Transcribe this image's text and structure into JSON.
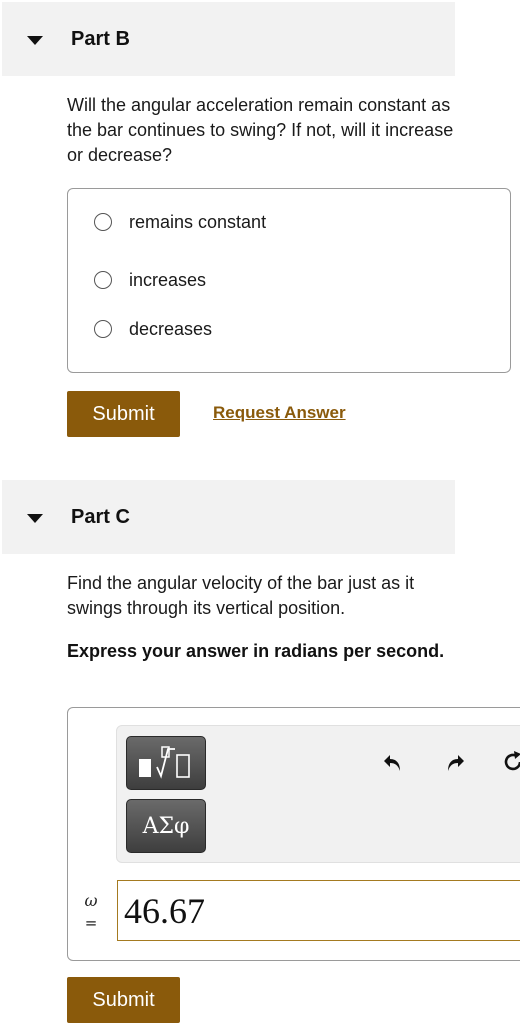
{
  "part_b": {
    "title": "Part B",
    "prompt": "Will the angular acceleration remain constant as the bar continues to swing? If not, will it increase or decrease?",
    "options": [
      {
        "label": "remains constant"
      },
      {
        "label": "increases"
      },
      {
        "label": "decreases"
      }
    ],
    "submit_label": "Submit",
    "request_answer_label": "Request Answer"
  },
  "part_c": {
    "title": "Part C",
    "prompt": "Find the angular velocity of the bar just as it swings through its vertical position.",
    "instruction": "Express your answer in radians per second.",
    "toolbar": {
      "symbols_label": "ΑΣφ",
      "icons": [
        "templates-icon",
        "undo-icon",
        "redo-icon",
        "reset-icon"
      ]
    },
    "variable": "ω",
    "equals": "=",
    "answer_value": "46.67",
    "submit_label": "Submit"
  },
  "colors": {
    "accent": "#8a5a0b",
    "header_bg": "#f2f2f2",
    "input_border": "#a47a20"
  }
}
